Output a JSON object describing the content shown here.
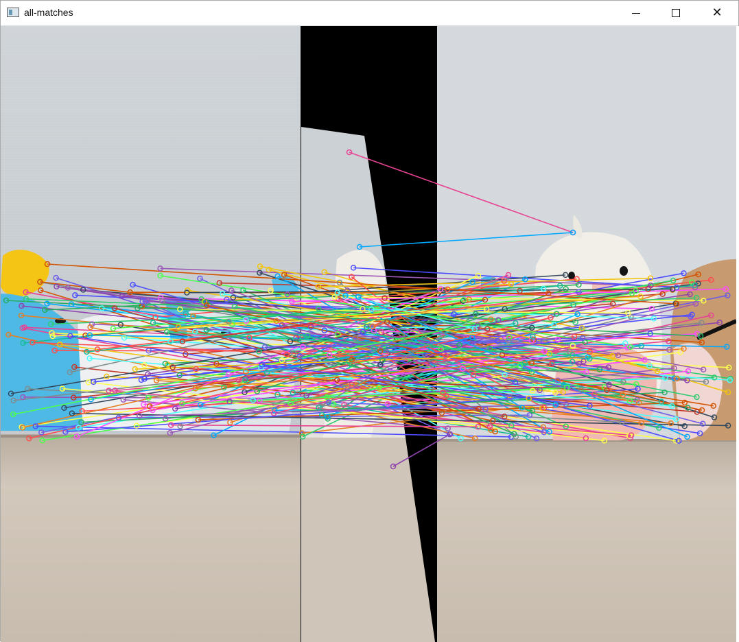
{
  "window": {
    "title": "all-matches",
    "app_icon": "opencv-window-icon",
    "controls": {
      "minimize_icon": "minimize-icon",
      "maximize_icon": "maximize-icon",
      "close_icon": "close-icon"
    }
  },
  "image": {
    "description_free": true,
    "panels": [
      "warped-left-image",
      "right-image"
    ],
    "match_colors": [
      "#ff4d4d",
      "#4dff4d",
      "#4d4dff",
      "#ff4dff",
      "#4dffff",
      "#ffff4d",
      "#9b59b6",
      "#e67e22",
      "#2ecc71",
      "#1abc9c",
      "#e84393",
      "#00a8ff",
      "#8e44ad",
      "#d35400",
      "#27ae60",
      "#c0392b",
      "#34495e",
      "#7f8c8d",
      "#f1c40f",
      "#6c5ce7"
    ]
  }
}
